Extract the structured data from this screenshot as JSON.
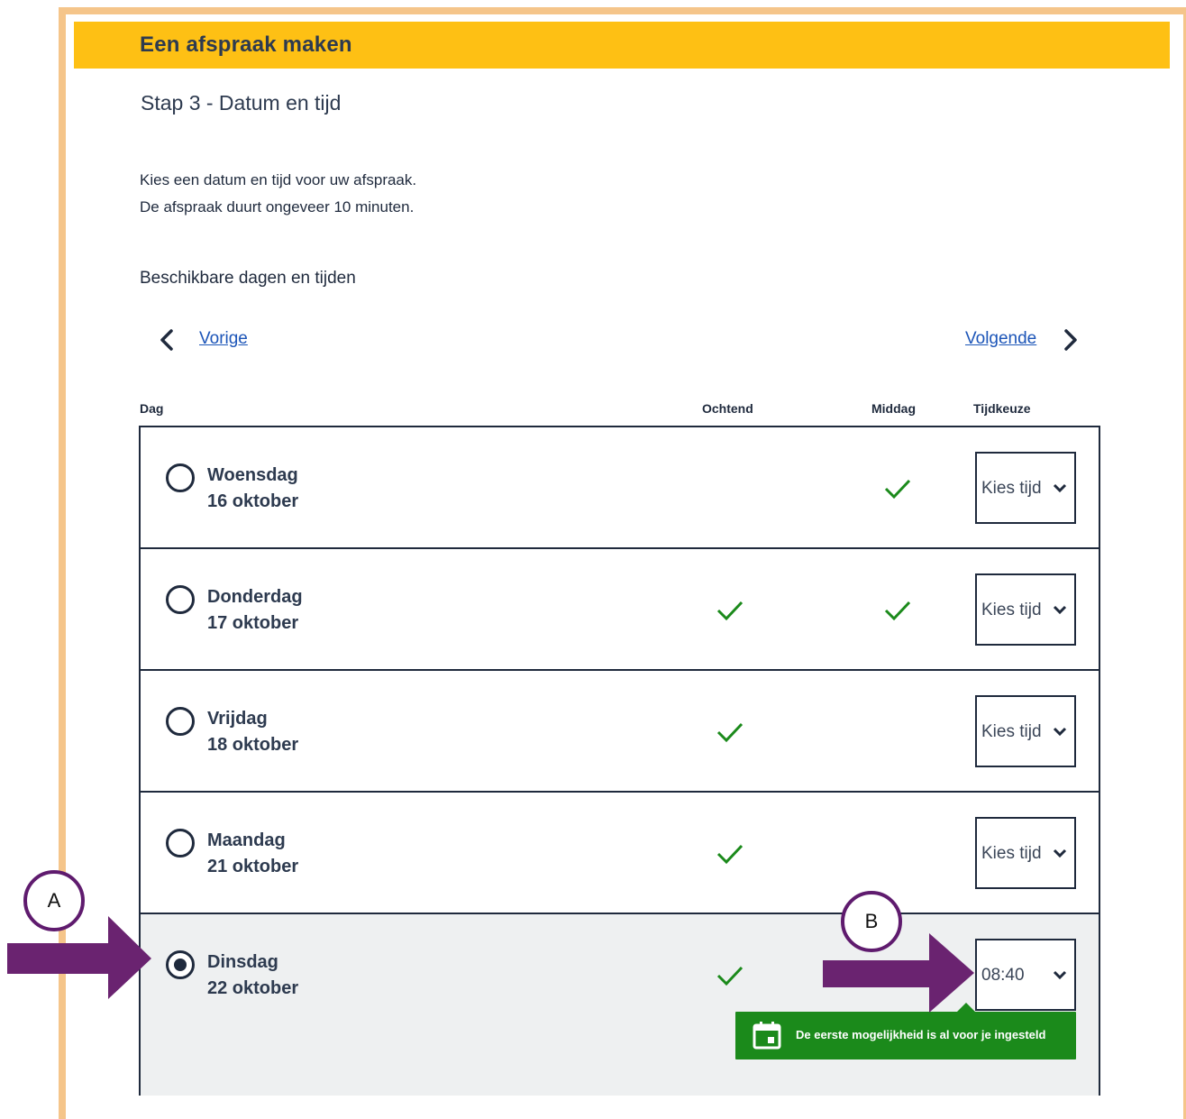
{
  "header": {
    "title": "Een afspraak maken"
  },
  "step": {
    "title": "Stap 3 - Datum en tijd"
  },
  "intro": {
    "line1": "Kies een datum en tijd voor uw afspraak.",
    "line2": "De afspraak duurt ongeveer 10 minuten."
  },
  "section": {
    "heading": "Beschikbare dagen en tijden"
  },
  "nav": {
    "prev_label": "Vorige",
    "next_label": "Volgende"
  },
  "columns": {
    "day": "Dag",
    "morning": "Ochtend",
    "afternoon": "Middag",
    "time": "Tijdkeuze"
  },
  "rows": [
    {
      "day": "Woensdag",
      "date": "16 oktober",
      "morning": false,
      "afternoon": true,
      "time": "Kies tijd",
      "selected": false
    },
    {
      "day": "Donderdag",
      "date": "17 oktober",
      "morning": true,
      "afternoon": true,
      "time": "Kies tijd",
      "selected": false
    },
    {
      "day": "Vrijdag",
      "date": "18 oktober",
      "morning": true,
      "afternoon": false,
      "time": "Kies tijd",
      "selected": false
    },
    {
      "day": "Maandag",
      "date": "21 oktober",
      "morning": true,
      "afternoon": false,
      "time": "Kies tijd",
      "selected": false
    },
    {
      "day": "Dinsdag",
      "date": "22 oktober",
      "morning": true,
      "afternoon": false,
      "time": "08:40",
      "selected": true
    }
  ],
  "toast": {
    "text": "De eerste mogelijkheid is al voor je ingesteld",
    "icon": "calendar-icon"
  },
  "callouts": {
    "a": "A",
    "b": "B"
  },
  "colors": {
    "header": "#fec014",
    "frame": "#f5c58a",
    "check": "#1b8a1b",
    "link": "#1c55b8",
    "annotation": "#6a2370",
    "selected_row": "#eef0f1"
  }
}
